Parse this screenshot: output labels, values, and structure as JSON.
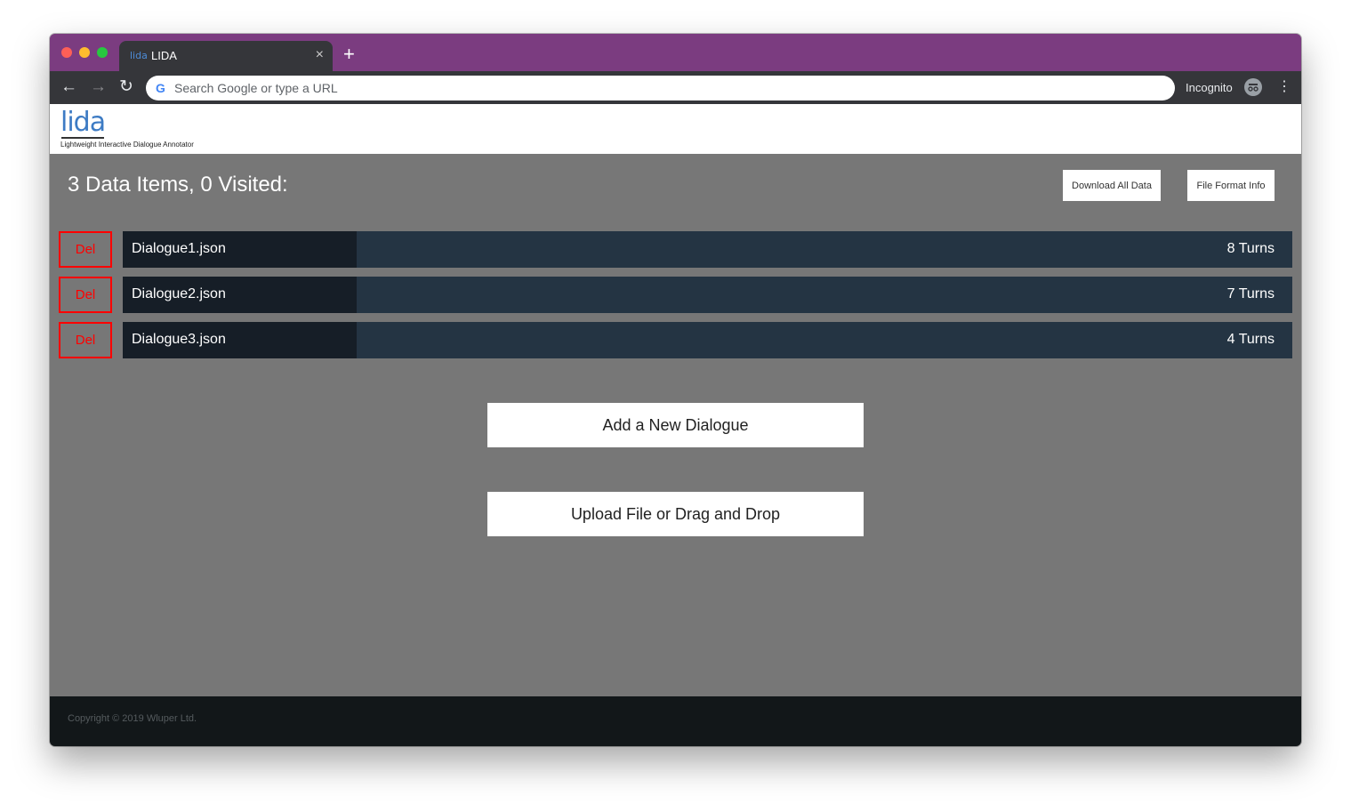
{
  "browser": {
    "tab_favicon_text": "lida",
    "tab_title": "LIDA",
    "tab_close": "×",
    "new_tab": "+",
    "back": "←",
    "forward": "→",
    "reload": "↻",
    "omnibox_icon": "G",
    "omnibox_placeholder": "Search Google or type a URL",
    "incognito_label": "Incognito",
    "incognito_icon": "incognito-icon",
    "menu": "⋮"
  },
  "header": {
    "logo_text": "lida",
    "tagline": "Lightweight Interactive Dialogue Annotator"
  },
  "main": {
    "count_title": "3 Data Items, 0 Visited:",
    "download_label": "Download All Data",
    "format_info_label": "File Format Info",
    "items": [
      {
        "delete_label": "Del",
        "name": "Dialogue1.json",
        "turns": "8 Turns"
      },
      {
        "delete_label": "Del",
        "name": "Dialogue2.json",
        "turns": "7 Turns"
      },
      {
        "delete_label": "Del",
        "name": "Dialogue3.json",
        "turns": "4 Turns"
      }
    ],
    "add_dialogue_label": "Add a New Dialogue",
    "upload_label": "Upload File or Drag and Drop"
  },
  "footer": {
    "copyright": "Copyright © 2019 Wluper Ltd."
  },
  "colors": {
    "tab_strip": "#7b3c80",
    "browser_chrome": "#35363a",
    "page_background": "#777777",
    "item_bar": "#243443",
    "item_name_cell": "#161e27",
    "delete_accent": "#ff0000",
    "footer": "#121719",
    "logo": "#3d7bc4"
  }
}
